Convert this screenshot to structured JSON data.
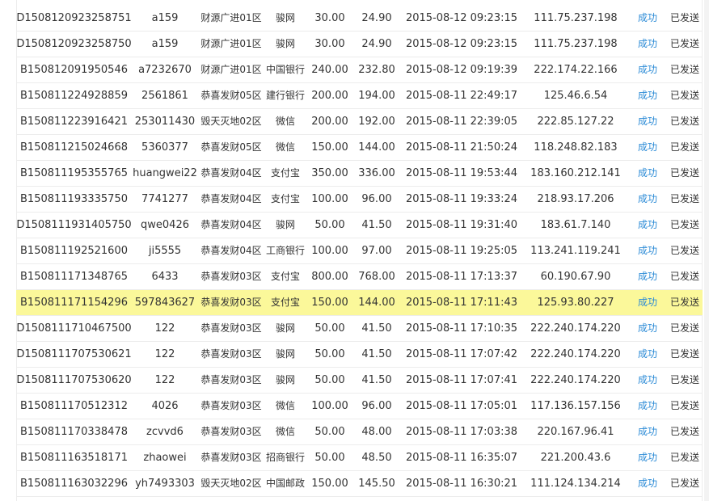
{
  "colors": {
    "highlight_row": "#fbf89a",
    "status_text": "#2a8ad6",
    "row_border": "#ececec"
  },
  "rows": [
    {
      "order_id": "D1508120923258751",
      "account": "a159",
      "server": "财源广进01区",
      "channel": "骏网",
      "amount": "30.00",
      "paid": "24.90",
      "time": "2015-08-12 09:23:15",
      "ip": "111.75.237.198",
      "status": "成功",
      "delivery": "已发送"
    },
    {
      "order_id": "D1508120923258750",
      "account": "a159",
      "server": "财源广进01区",
      "channel": "骏网",
      "amount": "30.00",
      "paid": "24.90",
      "time": "2015-08-12 09:23:15",
      "ip": "111.75.237.198",
      "status": "成功",
      "delivery": "已发送"
    },
    {
      "order_id": "B150812091950546",
      "account": "a7232670",
      "server": "财源广进01区",
      "channel": "中国银行",
      "amount": "240.00",
      "paid": "232.80",
      "time": "2015-08-12 09:19:39",
      "ip": "222.174.22.166",
      "status": "成功",
      "delivery": "已发送"
    },
    {
      "order_id": "B150811224928859",
      "account": "2561861",
      "server": "恭喜发财05区",
      "channel": "建行银行",
      "amount": "200.00",
      "paid": "194.00",
      "time": "2015-08-11 22:49:17",
      "ip": "125.46.6.54",
      "status": "成功",
      "delivery": "已发送"
    },
    {
      "order_id": "B150811223916421",
      "account": "253011430",
      "server": "毁天灭地02区",
      "channel": "微信",
      "amount": "200.00",
      "paid": "192.00",
      "time": "2015-08-11 22:39:05",
      "ip": "222.85.127.22",
      "status": "成功",
      "delivery": "已发送"
    },
    {
      "order_id": "B150811215024668",
      "account": "5360377",
      "server": "恭喜发财05区",
      "channel": "微信",
      "amount": "150.00",
      "paid": "144.00",
      "time": "2015-08-11 21:50:24",
      "ip": "118.248.82.183",
      "status": "成功",
      "delivery": "已发送"
    },
    {
      "order_id": "B150811195355765",
      "account": "huangwei22",
      "server": "恭喜发财04区",
      "channel": "支付宝",
      "amount": "350.00",
      "paid": "336.00",
      "time": "2015-08-11 19:53:44",
      "ip": "183.160.212.141",
      "status": "成功",
      "delivery": "已发送"
    },
    {
      "order_id": "B150811193335750",
      "account": "7741277",
      "server": "恭喜发财04区",
      "channel": "支付宝",
      "amount": "100.00",
      "paid": "96.00",
      "time": "2015-08-11 19:33:24",
      "ip": "218.93.17.206",
      "status": "成功",
      "delivery": "已发送"
    },
    {
      "order_id": "D1508111931405750",
      "account": "qwe0426",
      "server": "恭喜发财04区",
      "channel": "骏网",
      "amount": "50.00",
      "paid": "41.50",
      "time": "2015-08-11 19:31:40",
      "ip": "183.61.7.140",
      "status": "成功",
      "delivery": "已发送"
    },
    {
      "order_id": "B150811192521600",
      "account": "ji5555",
      "server": "恭喜发财04区",
      "channel": "工商银行",
      "amount": "100.00",
      "paid": "97.00",
      "time": "2015-08-11 19:25:05",
      "ip": "113.241.119.241",
      "status": "成功",
      "delivery": "已发送"
    },
    {
      "order_id": "B150811171348765",
      "account": "6433",
      "server": "恭喜发财03区",
      "channel": "支付宝",
      "amount": "800.00",
      "paid": "768.00",
      "time": "2015-08-11 17:13:37",
      "ip": "60.190.67.90",
      "status": "成功",
      "delivery": "已发送"
    },
    {
      "order_id": "B150811171154296",
      "account": "597843627",
      "server": "恭喜发财03区",
      "channel": "支付宝",
      "amount": "150.00",
      "paid": "144.00",
      "time": "2015-08-11 17:11:43",
      "ip": "125.93.80.227",
      "status": "成功",
      "delivery": "已发送"
    },
    {
      "order_id": "D1508111710467500",
      "account": "122",
      "server": "恭喜发财03区",
      "channel": "骏网",
      "amount": "50.00",
      "paid": "41.50",
      "time": "2015-08-11 17:10:35",
      "ip": "222.240.174.220",
      "status": "成功",
      "delivery": "已发送"
    },
    {
      "order_id": "D1508111707530621",
      "account": "122",
      "server": "恭喜发财03区",
      "channel": "骏网",
      "amount": "50.00",
      "paid": "41.50",
      "time": "2015-08-11 17:07:42",
      "ip": "222.240.174.220",
      "status": "成功",
      "delivery": "已发送"
    },
    {
      "order_id": "D1508111707530620",
      "account": "122",
      "server": "恭喜发财03区",
      "channel": "骏网",
      "amount": "50.00",
      "paid": "41.50",
      "time": "2015-08-11 17:07:41",
      "ip": "222.240.174.220",
      "status": "成功",
      "delivery": "已发送"
    },
    {
      "order_id": "B150811170512312",
      "account": "4026",
      "server": "恭喜发财03区",
      "channel": "微信",
      "amount": "100.00",
      "paid": "96.00",
      "time": "2015-08-11 17:05:01",
      "ip": "117.136.157.156",
      "status": "成功",
      "delivery": "已发送"
    },
    {
      "order_id": "B150811170338478",
      "account": "zcvvd6",
      "server": "恭喜发财03区",
      "channel": "微信",
      "amount": "50.00",
      "paid": "48.00",
      "time": "2015-08-11 17:03:38",
      "ip": "220.167.96.41",
      "status": "成功",
      "delivery": "已发送"
    },
    {
      "order_id": "B150811163518171",
      "account": "zhaowei",
      "server": "恭喜发财03区",
      "channel": "招商银行",
      "amount": "50.00",
      "paid": "48.50",
      "time": "2015-08-11 16:35:07",
      "ip": "221.200.43.6",
      "status": "成功",
      "delivery": "已发送"
    },
    {
      "order_id": "B150811163032296",
      "account": "yh7493303",
      "server": "毁天灭地02区",
      "channel": "中国邮政",
      "amount": "150.00",
      "paid": "145.50",
      "time": "2015-08-11 16:30:21",
      "ip": "111.124.134.214",
      "status": "成功",
      "delivery": "已发送"
    }
  ]
}
